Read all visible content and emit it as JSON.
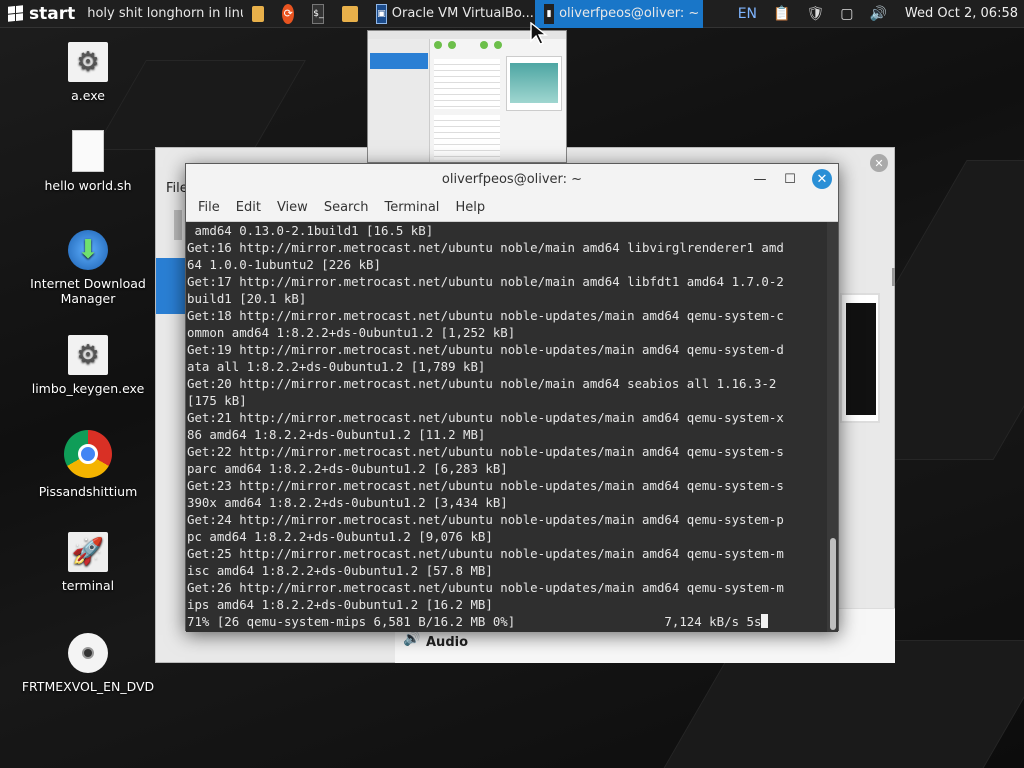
{
  "taskbar": {
    "start_label": "start",
    "tasks": [
      {
        "label": "holy shit longhorn in linux",
        "icon": "window-icon"
      },
      {
        "label": "",
        "icon": "folder-icon"
      },
      {
        "label": "",
        "icon": "ubuntu-icon"
      },
      {
        "label": "",
        "icon": "terminal-icon"
      },
      {
        "label": "",
        "icon": "folder-icon"
      },
      {
        "label": "Oracle VM VirtualBo...",
        "icon": "virtualbox-icon"
      },
      {
        "label": "oliverfpeos@oliver: ~",
        "icon": "terminal-icon"
      }
    ],
    "tray": {
      "lang": "EN",
      "clock": "Wed Oct 2, 06:58"
    }
  },
  "desktop": {
    "icons": [
      {
        "label": "a.exe",
        "icon": "gear-icon"
      },
      {
        "label": "hello world.sh",
        "icon": "document-icon"
      },
      {
        "label": "Internet Download Manager",
        "icon": "download-icon"
      },
      {
        "label": "limbo_keygen.exe",
        "icon": "gear-icon"
      },
      {
        "label": "Pissandshittium",
        "icon": "chrome-icon"
      },
      {
        "label": "terminal",
        "icon": "rocket-icon"
      },
      {
        "label": "FRTMEXVOL_EN_DVD",
        "icon": "disc-icon"
      }
    ]
  },
  "vbox": {
    "menu_partial": "File",
    "section_audio": "Audio"
  },
  "terminal": {
    "title": "oliverfpeos@oliver: ~",
    "menu": [
      "File",
      "Edit",
      "View",
      "Search",
      "Terminal",
      "Help"
    ],
    "lines": [
      " amd64 0.13.0-2.1build1 [16.5 kB]",
      "Get:16 http://mirror.metrocast.net/ubuntu noble/main amd64 libvirglrenderer1 amd",
      "64 1.0.0-1ubuntu2 [226 kB]",
      "Get:17 http://mirror.metrocast.net/ubuntu noble/main amd64 libfdt1 amd64 1.7.0-2",
      "build1 [20.1 kB]",
      "Get:18 http://mirror.metrocast.net/ubuntu noble-updates/main amd64 qemu-system-c",
      "ommon amd64 1:8.2.2+ds-0ubuntu1.2 [1,252 kB]",
      "Get:19 http://mirror.metrocast.net/ubuntu noble-updates/main amd64 qemu-system-d",
      "ata all 1:8.2.2+ds-0ubuntu1.2 [1,789 kB]",
      "Get:20 http://mirror.metrocast.net/ubuntu noble/main amd64 seabios all 1.16.3-2",
      "[175 kB]",
      "Get:21 http://mirror.metrocast.net/ubuntu noble-updates/main amd64 qemu-system-x",
      "86 amd64 1:8.2.2+ds-0ubuntu1.2 [11.2 MB]",
      "Get:22 http://mirror.metrocast.net/ubuntu noble-updates/main amd64 qemu-system-s",
      "parc amd64 1:8.2.2+ds-0ubuntu1.2 [6,283 kB]",
      "Get:23 http://mirror.metrocast.net/ubuntu noble-updates/main amd64 qemu-system-s",
      "390x amd64 1:8.2.2+ds-0ubuntu1.2 [3,434 kB]",
      "Get:24 http://mirror.metrocast.net/ubuntu noble-updates/main amd64 qemu-system-p",
      "pc amd64 1:8.2.2+ds-0ubuntu1.2 [9,076 kB]",
      "Get:25 http://mirror.metrocast.net/ubuntu noble-updates/main amd64 qemu-system-m",
      "isc amd64 1:8.2.2+ds-0ubuntu1.2 [57.8 MB]",
      "Get:26 http://mirror.metrocast.net/ubuntu noble-updates/main amd64 qemu-system-m",
      "ips amd64 1:8.2.2+ds-0ubuntu1.2 [16.2 MB]"
    ],
    "progress_line": "71% [26 qemu-system-mips 6,581 B/16.2 MB 0%]                    7,124 kB/s 5s"
  }
}
